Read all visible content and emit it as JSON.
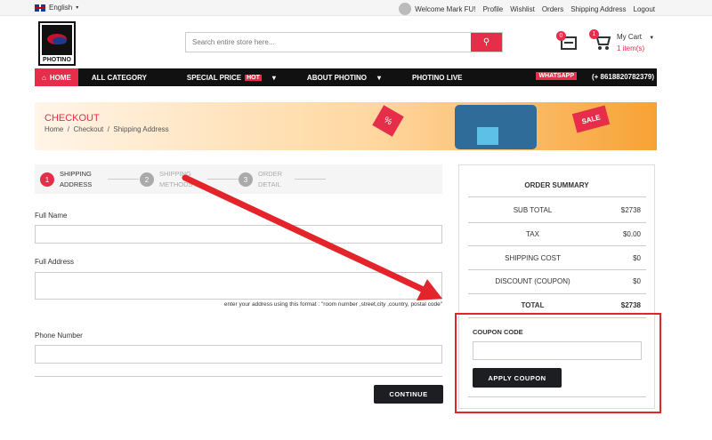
{
  "topbar": {
    "language": "English",
    "welcome": "Welcome Mark FU!",
    "links": [
      "Profile",
      "Wishlist",
      "Orders",
      "Shipping Address",
      "Logout"
    ]
  },
  "header": {
    "logo_text": "PHOTINO",
    "search_placeholder": "Search entire store here...",
    "wishlist_count": "0",
    "cart_count": "1",
    "cart_label": "My Cart",
    "cart_items": "1 item(s)"
  },
  "nav": {
    "home": "HOME",
    "items": [
      "ALL CATEGORY",
      "SPECIAL PRICE",
      "ABOUT PHOTINO",
      "PHOTINO LIVE"
    ],
    "hot": "HOT",
    "whatsapp": "WHATSAPP",
    "phone": "(+ 8618820782379)"
  },
  "banner": {
    "title": "CHECKOUT",
    "crumbs": [
      "Home",
      "Checkout",
      "Shipping Address"
    ],
    "sale_tag": "SALE",
    "pct": "%"
  },
  "steps": [
    {
      "num": "1",
      "line1": "SHIPPING",
      "line2": "ADDRESS"
    },
    {
      "num": "2",
      "line1": "SHIPPING",
      "line2": "METHODS"
    },
    {
      "num": "3",
      "line1": "ORDER",
      "line2": "DETAIL"
    }
  ],
  "form": {
    "full_name_label": "Full Name",
    "full_address_label": "Full Address",
    "address_hint": "enter your address using this format : \"room number ,street,city ,country, postal code\"",
    "phone_label": "Phone Number",
    "continue": "CONTINUE"
  },
  "summary": {
    "title": "ORDER SUMMARY",
    "rows": [
      {
        "k": "SUB TOTAL",
        "v": "$2738"
      },
      {
        "k": "TAX",
        "v": "$0.00"
      },
      {
        "k": "SHIPPING COST",
        "v": "$0"
      },
      {
        "k": "DISCOUNT (COUPON)",
        "v": "$0"
      },
      {
        "k": "TOTAL",
        "v": "$2738"
      }
    ],
    "coupon_label": "COUPON CODE",
    "apply": "APPLY COUPON"
  },
  "colors": {
    "accent": "#e62e4b",
    "dark": "#1c1e22",
    "annotation": "#e3242b"
  }
}
